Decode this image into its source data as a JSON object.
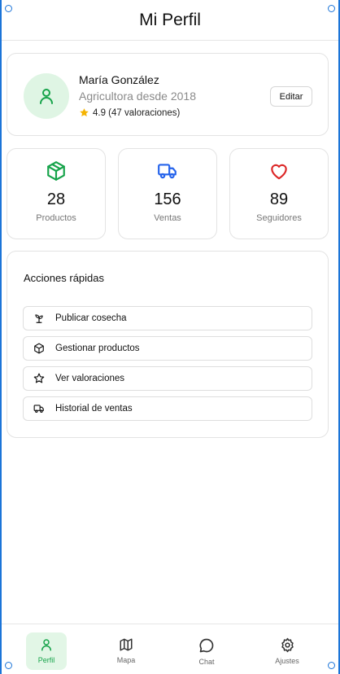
{
  "header": {
    "title": "Mi Perfil"
  },
  "profile": {
    "name": "María González",
    "role": "Agricultora desde 2018",
    "rating": "4.9 (47 valoraciones)",
    "edit_label": "Editar"
  },
  "stats": [
    {
      "value": "28",
      "label": "Productos",
      "icon": "box-icon",
      "color": "#16a34a"
    },
    {
      "value": "156",
      "label": "Ventas",
      "icon": "truck-icon",
      "color": "#2563eb"
    },
    {
      "value": "89",
      "label": "Seguidores",
      "icon": "heart-icon",
      "color": "#dc2626"
    }
  ],
  "actions": {
    "title": "Acciones rápidas",
    "items": [
      {
        "label": "Publicar cosecha",
        "icon": "sprout-icon"
      },
      {
        "label": "Gestionar productos",
        "icon": "box-icon"
      },
      {
        "label": "Ver valoraciones",
        "icon": "star-icon"
      },
      {
        "label": "Historial de ventas",
        "icon": "truck-icon"
      }
    ]
  },
  "nav": {
    "items": [
      {
        "label": "Perfil",
        "icon": "user-icon",
        "active": true
      },
      {
        "label": "Mapa",
        "icon": "map-icon",
        "active": false
      },
      {
        "label": "Chat",
        "icon": "chat-icon",
        "active": false
      },
      {
        "label": "Ajustes",
        "icon": "gear-icon",
        "active": false
      }
    ]
  },
  "colors": {
    "accent": "#16a34a",
    "star": "#f5b301",
    "frame": "#1b74d8"
  }
}
